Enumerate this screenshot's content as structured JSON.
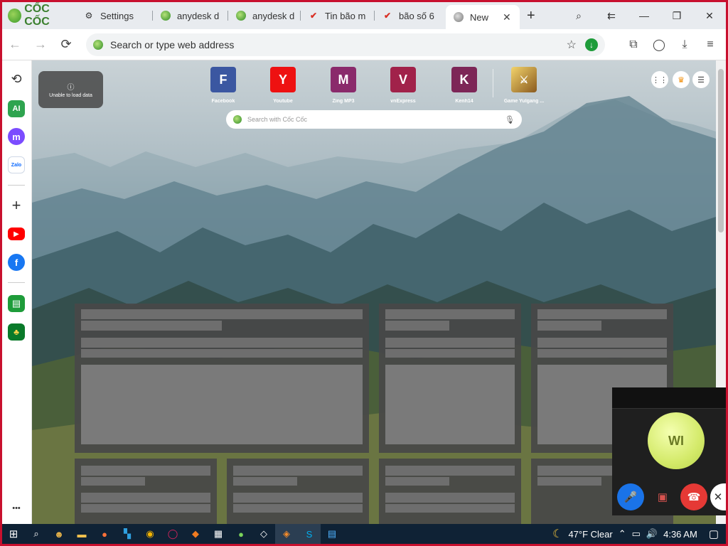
{
  "browser": {
    "brand": "CỐC CỐC",
    "tabs": [
      {
        "label": "Settings",
        "icon": "gear-icon"
      },
      {
        "label": "anydesk d",
        "icon": "coccoc-icon"
      },
      {
        "label": "anydesk d",
        "icon": "coccoc-icon"
      },
      {
        "label": "Tin bão m",
        "icon": "news-icon"
      },
      {
        "label": "bão số 6",
        "icon": "news-icon"
      },
      {
        "label": "New",
        "icon": "coccoc-icon",
        "active": true
      }
    ],
    "new_tab": "+",
    "window": {
      "history": "⇇",
      "minimize": "—",
      "maximize": "❐",
      "close": "✕"
    }
  },
  "toolbar": {
    "back": "←",
    "forward": "→",
    "reload": "⟳",
    "address_placeholder": "Search or type web address",
    "star": "☆",
    "download_badge": "↓",
    "extensions": "⧉",
    "profile": "◯",
    "downloads": "⤓",
    "menu": "≡"
  },
  "sidebar": {
    "items": [
      {
        "name": "history",
        "glyph": "⟲",
        "color": "#333"
      },
      {
        "name": "ai",
        "glyph": "AI",
        "color": "#2ea44f"
      },
      {
        "name": "messenger",
        "glyph": "m",
        "color": "#7b4cff"
      },
      {
        "name": "zalo",
        "glyph": "Zalo",
        "color": "#0a68ff"
      },
      {
        "name": "add",
        "glyph": "+",
        "color": "#333"
      },
      {
        "name": "youtube",
        "glyph": "▶",
        "color": "#ff0000"
      },
      {
        "name": "facebook",
        "glyph": "f",
        "color": "#1877f2"
      },
      {
        "name": "notes",
        "glyph": "▤",
        "color": "#1e9c3a"
      },
      {
        "name": "game",
        "glyph": "♣",
        "color": "#0a7a2a"
      },
      {
        "name": "more",
        "glyph": "•••",
        "color": "#333"
      }
    ]
  },
  "newtab": {
    "weather_error": "Unable to load data",
    "search_placeholder": "Search with Cốc Cốc",
    "speed_dial": [
      {
        "letter": "F",
        "label": "Facebook",
        "color": "#3b57a1"
      },
      {
        "letter": "Y",
        "label": "Youtube",
        "color": "#ee1111"
      },
      {
        "letter": "M",
        "label": "Zing MP3",
        "color": "#8a2a6b"
      },
      {
        "letter": "V",
        "label": "vnExpress",
        "color": "#a1224a"
      },
      {
        "letter": "K",
        "label": "Kenh14",
        "color": "#7d2657"
      },
      {
        "letter": "",
        "label": "Game Yulgang ...",
        "color": "#c9a13a"
      }
    ]
  },
  "call": {
    "initials": "WI",
    "mute": "🎤",
    "video_off": "▣",
    "hangup": "☎",
    "more": "✕"
  },
  "taskbar": {
    "weather": "47°F  Clear",
    "time": "4:36 AM"
  }
}
